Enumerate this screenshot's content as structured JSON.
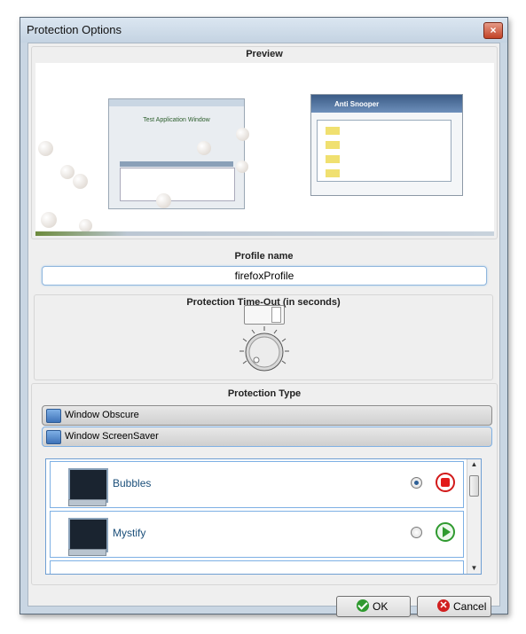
{
  "window": {
    "title": "Protection Options",
    "close_glyph": "×"
  },
  "preview": {
    "label": "Preview",
    "left_thumb_title": "Test Application Window",
    "right_thumb_title": "Anti Snooper"
  },
  "profile": {
    "label": "Profile name",
    "value": "firefoxProfile"
  },
  "timeout": {
    "label": "Protection Time-Out (in seconds)",
    "value": ""
  },
  "protection_type": {
    "label": "Protection Type",
    "groups": [
      {
        "label": "Window Obscure",
        "icon": "window-icon"
      },
      {
        "label": "Window ScreenSaver",
        "icon": "window-icon"
      }
    ],
    "items": [
      {
        "name": "Bubbles",
        "selected": true,
        "action": "stop-icon"
      },
      {
        "name": "Mystify",
        "selected": false,
        "action": "play-icon"
      }
    ]
  },
  "buttons": {
    "ok": "OK",
    "cancel": "Cancel"
  },
  "colors": {
    "accent": "#7eb0e4",
    "stop": "#e21b1b",
    "play": "#2f9a2f"
  }
}
